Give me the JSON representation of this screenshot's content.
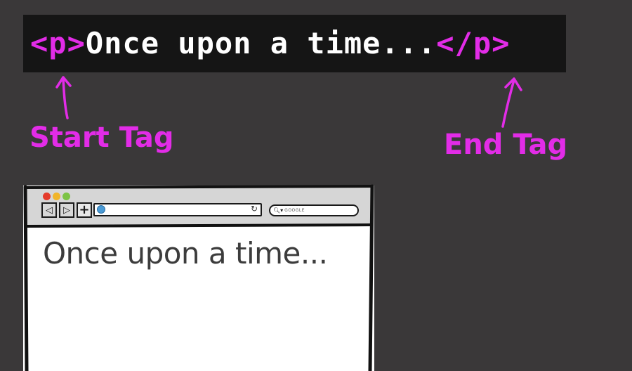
{
  "code": {
    "open_tag": "<p>",
    "content": "Once upon a time...",
    "close_tag": "</p>"
  },
  "labels": {
    "start_tag": "Start Tag",
    "end_tag": "End Tag"
  },
  "browser": {
    "search_placeholder": "Google",
    "page_text": "Once upon a time..."
  },
  "colors": {
    "accent": "#e22ce7",
    "code_background": "#151515",
    "page_background": "#3a3839"
  },
  "icons": {
    "back": "back-arrow-icon",
    "forward": "forward-arrow-icon",
    "new_tab": "plus-icon",
    "address": "globe-icon",
    "reload": "reload-icon",
    "search": "search-icon"
  }
}
